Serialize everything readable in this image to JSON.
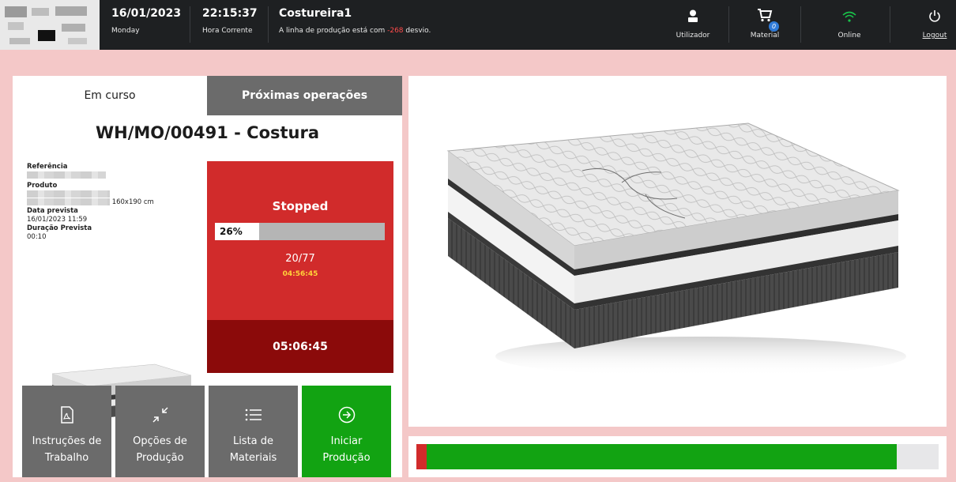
{
  "header": {
    "date": "16/01/2023",
    "weekday": "Monday",
    "time": "22:15:37",
    "time_label": "Hora Corrente",
    "user": "Costureira1",
    "message_prefix": "A linha de produção está com ",
    "message_value": "-268",
    "message_suffix": " desvio.",
    "utilizador_label": "Utilizador",
    "material_label": "Material",
    "material_badge": "0",
    "online_label": "Online",
    "logout_label": "Logout"
  },
  "tabs": {
    "active": "Em curso",
    "inactive": "Próximas operações"
  },
  "order": {
    "title": "WH/MO/00491 - Costura",
    "referencia_label": "Referência",
    "produto_label": "Produto",
    "produto_size": "160x190 cm",
    "data_label": "Data prevista",
    "data_value": "16/01/2023 11:59",
    "duracao_label": "Duração Prevista",
    "duracao_value": "00:10"
  },
  "status": {
    "state": "Stopped",
    "progress": 0.26,
    "progress_label": "26%",
    "count": "20/77",
    "elapsed": "04:56:45",
    "total": "05:06:45"
  },
  "buttons": [
    {
      "line1": "Instruções de",
      "line2": "Trabalho",
      "icon": "pdf-file-icon"
    },
    {
      "line1": "Opções de",
      "line2": "Produção",
      "icon": "collapse-arrows-icon"
    },
    {
      "line1": "Lista de",
      "line2": "Materiais",
      "icon": "list-icon"
    },
    {
      "line1": "Iniciar",
      "line2": "Produção",
      "icon": "arrow-circle-right-icon"
    }
  ],
  "overall_progress": {
    "red_fraction": 0.02,
    "green_fraction": 0.9
  },
  "colors": {
    "header_bg": "#1e2022",
    "page_bg": "#f4c8c8",
    "status_red": "#d12b2b",
    "status_dark_red": "#8b0a0a",
    "green": "#12a312",
    "gray": "#6b6b6b",
    "wifi": "#19c24a"
  }
}
